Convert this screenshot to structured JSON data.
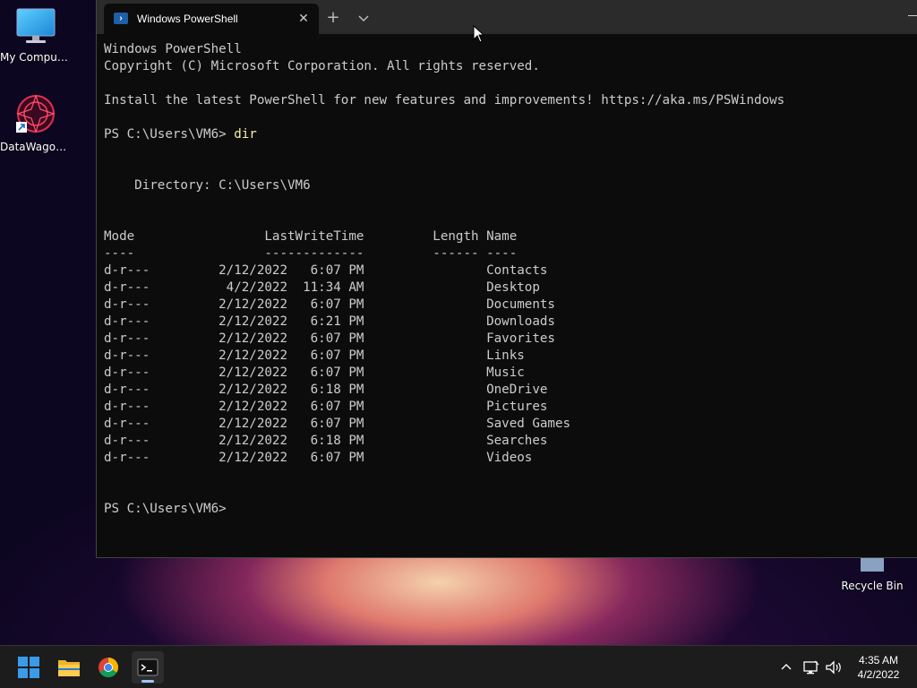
{
  "desktop": {
    "icons": [
      {
        "label": "My Computer"
      },
      {
        "label": "DataWagon..."
      },
      {
        "label": "Recycle Bin"
      }
    ]
  },
  "window": {
    "tab_title": "Windows PowerShell",
    "tab_close": "✕",
    "new_tab": "+"
  },
  "console": {
    "lines": [
      "Windows PowerShell",
      "Copyright (C) Microsoft Corporation. All rights reserved.",
      "",
      "Install the latest PowerShell for new features and improvements! https://aka.ms/PSWindows",
      "",
      "PS C:\\Users\\VM6> ",
      "",
      "",
      "    Directory: C:\\Users\\VM6",
      "",
      "",
      "Mode                 LastWriteTime         Length Name",
      "----                 -------------         ------ ----",
      "d-r---         2/12/2022   6:07 PM                Contacts",
      "d-r---          4/2/2022  11:34 AM                Desktop",
      "d-r---         2/12/2022   6:07 PM                Documents",
      "d-r---         2/12/2022   6:21 PM                Downloads",
      "d-r---         2/12/2022   6:07 PM                Favorites",
      "d-r---         2/12/2022   6:07 PM                Links",
      "d-r---         2/12/2022   6:07 PM                Music",
      "d-r---         2/12/2022   6:18 PM                OneDrive",
      "d-r---         2/12/2022   6:07 PM                Pictures",
      "d-r---         2/12/2022   6:07 PM                Saved Games",
      "d-r---         2/12/2022   6:18 PM                Searches",
      "d-r---         2/12/2022   6:07 PM                Videos",
      "",
      "",
      "PS C:\\Users\\VM6> "
    ],
    "command": "dir"
  },
  "taskbar": {
    "apps": [
      "windows-start-icon",
      "file-explorer-icon",
      "chrome-icon",
      "terminal-icon"
    ],
    "clock_time": "4:35 AM",
    "clock_date": "4/2/2022"
  },
  "colors": {
    "console_bg": "#0c0c0c",
    "console_text": "#cccccc",
    "command_text": "#f9f1a5",
    "taskbar_bg": "#1c1c1c",
    "start_blue": "#3a9be8"
  }
}
